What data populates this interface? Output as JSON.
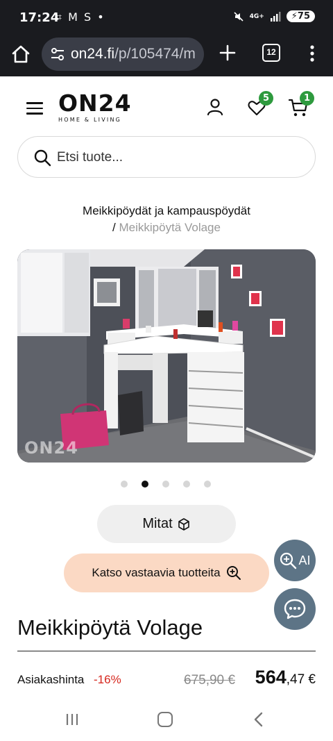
{
  "status_bar": {
    "time": "17:24",
    "notification_icons": "⌗ M S •",
    "network": "4G+",
    "battery": "75"
  },
  "browser": {
    "url_host": "on24.fi",
    "url_path": "/p/105474/m",
    "tab_count": "12"
  },
  "site": {
    "logo": "ON24",
    "logo_tagline": "HOME & LIVING",
    "favorites_count": "5",
    "cart_count": "1",
    "search_placeholder": "Etsi tuote..."
  },
  "breadcrumb": {
    "parent": "Meikkipöydät ja kampauspöydät",
    "separator": "/",
    "current": "Meikkipöytä Volage"
  },
  "gallery": {
    "watermark": "ON24",
    "dots_count": 5,
    "active_index": 1
  },
  "actions": {
    "dimensions_label": "Mitat",
    "similar_label": "Katso vastaavia tuotteita",
    "ai_label": "AI"
  },
  "product": {
    "title": "Meikkipöytä Volage",
    "price_label": "Asiakashinta",
    "discount": "-16%",
    "old_price": "675,90 €",
    "new_price_int": "564",
    "new_price_dec": ",47 €"
  },
  "colors": {
    "accent_green": "#2e9a3e",
    "discount_red": "#d6271e",
    "similar_bg": "#fbd9c4",
    "fab_bg": "#5d7486"
  }
}
